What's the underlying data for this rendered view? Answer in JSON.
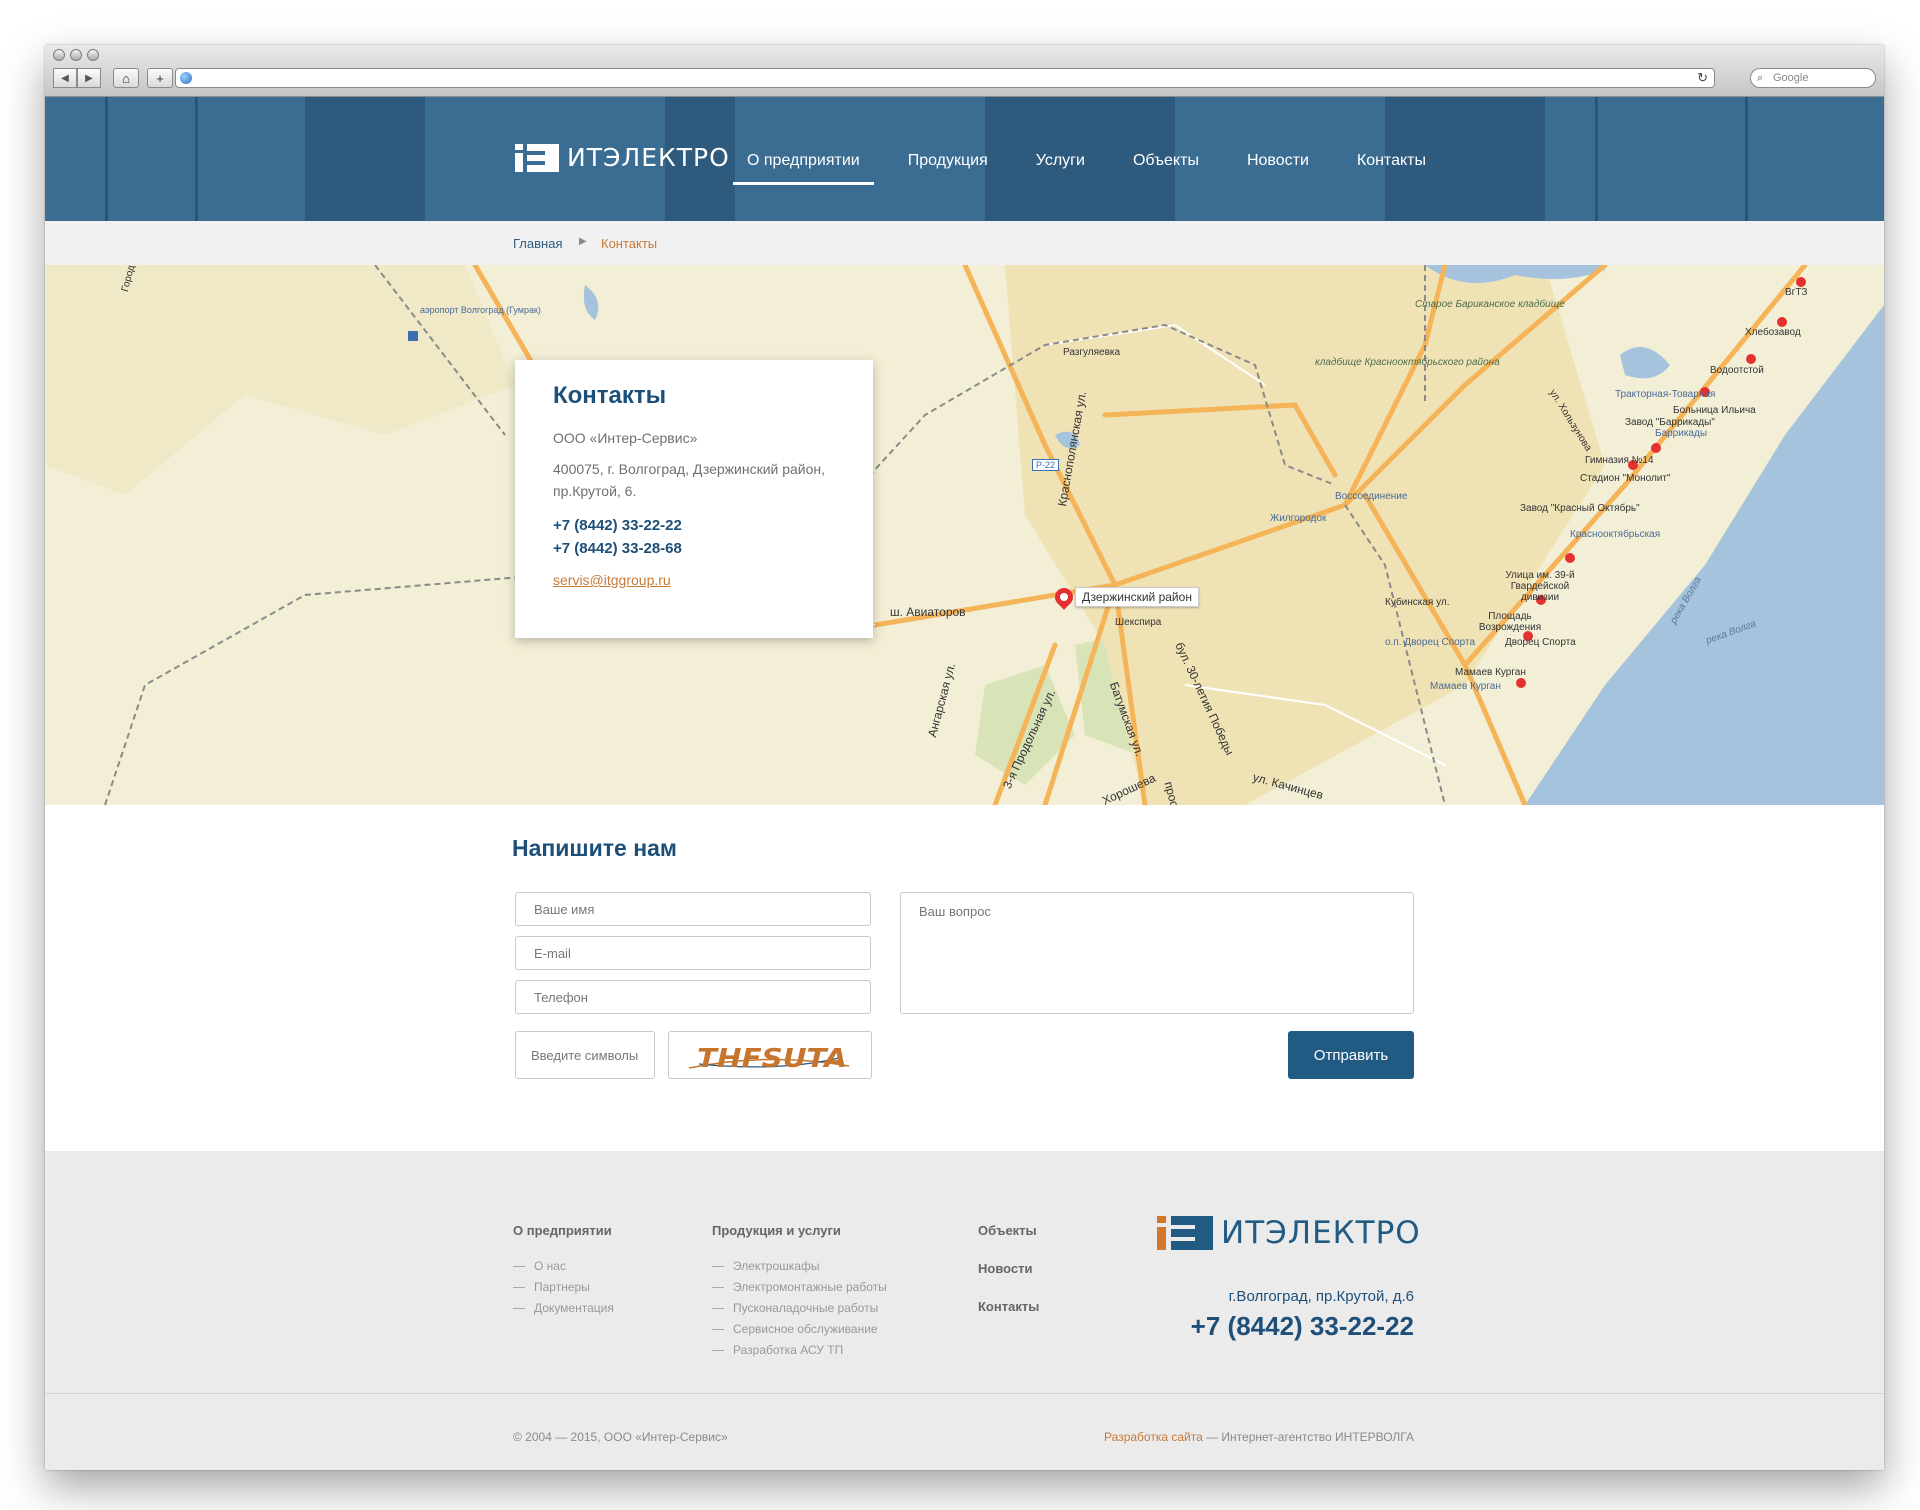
{
  "browser": {
    "search_placeholder": "Google"
  },
  "header": {
    "logo_text": "ИТЭЛЕКТРО",
    "nav": [
      {
        "label": "О предприятии",
        "active": true
      },
      {
        "label": "Продукция"
      },
      {
        "label": "Услуги"
      },
      {
        "label": "Объекты"
      },
      {
        "label": "Новости"
      },
      {
        "label": "Контакты"
      }
    ]
  },
  "breadcrumbs": {
    "home": "Главная",
    "current": "Контакты"
  },
  "map": {
    "labels": [
      "аэропорт Волгоград (Гумрак)",
      "Разгуляевка",
      "Старое Бариканское кладбище",
      "кладбище Краснооктябрьского района",
      "ул. Хользунова",
      "Тракторная-Товарная",
      "Жилгородок",
      "Воссоединение",
      "ВгТЗ",
      "Хлебозавод",
      "Водоотстой",
      "Больница Ильича",
      "Завод \"Баррикады\"",
      "Баррикады",
      "Гимназия №14",
      "Стадион \"Монолит\"",
      "Завод \"Красный Октябрь\"",
      "Краснооктябрьская",
      "Улица им. 39-й Гвардейской дивизии",
      "Площадь Возрождения",
      "Дворец Спорта",
      "о.п. Дворец Спорта",
      "Мамаев Курган",
      "Мамаев Курган",
      "Кубинская ул.",
      "река Волга",
      "река Волга",
      "Город"
    ],
    "road_labels": [
      "Р-22",
      "Краснополянская ул.",
      "ш. Авиаторов",
      "Ангарская ул.",
      "3-я Продольная ул.",
      "Батумская ул.",
      "бул. 30-летия Победы",
      "Хорошева",
      "просп.",
      "ул. Качинцев",
      "Шекспира"
    ],
    "pin_label": "Дзержинский район",
    "colors": {
      "land": "#f3efd6",
      "water": "#a5c3dd",
      "road": "#f4b457",
      "green": "#d9e3b8"
    }
  },
  "contact_card": {
    "title": "Контакты",
    "company": "ООО «Интер-Сервис»",
    "address": "400075, г. Волгоград, Дзержинский район, пр.Крутой, 6.",
    "phone1": "+7 (8442) 33-22-22",
    "phone2": "+7 (8442) 33-28-68",
    "email": "servis@itggroup.ru"
  },
  "form": {
    "title": "Напишите нам",
    "name_placeholder": "Ваше имя",
    "email_placeholder": "E-mail",
    "phone_placeholder": "Телефон",
    "question_placeholder": "Ваш вопрос",
    "captcha_placeholder": "Введите символы",
    "captcha_text": "THFSUTA",
    "submit_label": "Отправить"
  },
  "footer": {
    "columns": [
      {
        "title": "О предприятии",
        "items": [
          "О нас",
          "Партнеры",
          "Документация"
        ]
      },
      {
        "title": "Продукция и услуги",
        "items": [
          "Электрошкафы",
          "Электромонтажные работы",
          "Пусконаладочные работы",
          "Сервисное обслуживание",
          "Разработка АСУ ТП"
        ]
      }
    ],
    "nav": [
      "Объекты",
      "Новости",
      "Контакты"
    ],
    "logo_text": "ИТЭЛЕКТРО",
    "address": "г.Волгоград, пр.Крутой, д.6",
    "phone": "+7 (8442) 33-22-22",
    "copyright": "© 2004 — 2015, ООО «Интер-Сервис»",
    "dev_link": "Разработка сайта",
    "dev_text": " — Интернет-агентство ИНТЕРВОЛГА"
  },
  "colors": {
    "header_bg": "#3b6d93",
    "primary": "#1d4f79",
    "accent": "#c67b3a",
    "button": "#215a82",
    "footer_bg": "#ebebeb"
  }
}
